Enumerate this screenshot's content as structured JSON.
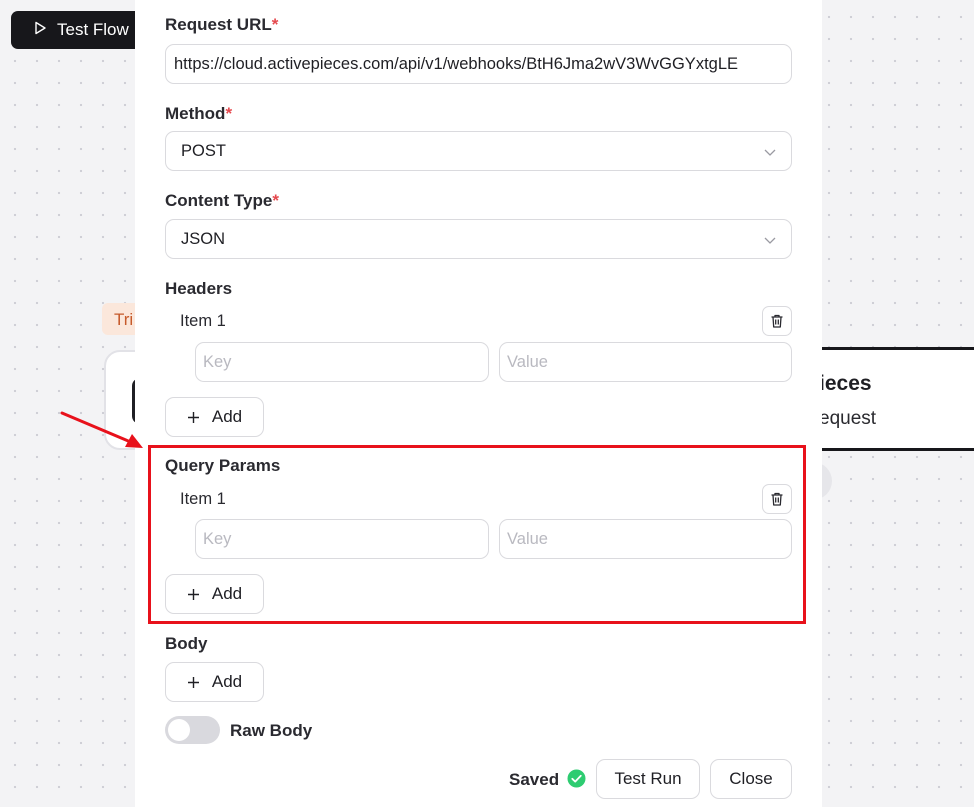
{
  "background": {
    "test_flow_label": "Test Flow",
    "trigger_badge_text": "Tri",
    "node_title_partial": "ieces",
    "node_subtitle_partial": "equest"
  },
  "form": {
    "request_url": {
      "label": "Request URL",
      "required_mark": "*",
      "value": "https://cloud.activepieces.com/api/v1/webhooks/BtH6Jma2wV3WvGGYxtgLE"
    },
    "method": {
      "label": "Method",
      "required_mark": "*",
      "value": "POST"
    },
    "content_type": {
      "label": "Content Type",
      "required_mark": "*",
      "value": "JSON"
    },
    "headers": {
      "label": "Headers",
      "item_label": "Item 1",
      "key_placeholder": "Key",
      "value_placeholder": "Value",
      "add_label": "Add"
    },
    "query_params": {
      "label": "Query Params",
      "item_label": "Item 1",
      "key_placeholder": "Key",
      "value_placeholder": "Value",
      "add_label": "Add"
    },
    "body": {
      "label": "Body",
      "add_label": "Add"
    },
    "raw_body": {
      "label": "Raw Body",
      "enabled": false
    }
  },
  "footer": {
    "status_label": "Saved",
    "test_run_label": "Test Run",
    "close_label": "Close"
  },
  "colors": {
    "required": "#e5484d",
    "saved_indicator": "#2ecc71",
    "highlight": "#e8111b",
    "dark_button": "#17171b"
  },
  "icons": {
    "test_flow": "play-icon",
    "dropdown": "chevron-down-icon",
    "delete_item": "trash-icon",
    "add": "plus-icon",
    "saved": "check-circle-icon"
  }
}
